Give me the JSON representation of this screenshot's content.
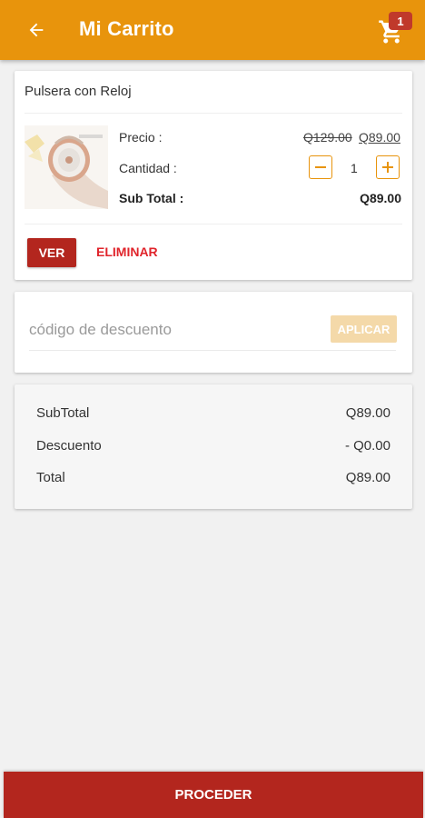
{
  "colors": {
    "brand": "#e8940c",
    "danger": "#b3261e",
    "link_danger": "#e0242b",
    "apply_disabled": "#f4d9a9"
  },
  "header": {
    "title": "Mi Carrito",
    "back_icon": "arrow-left-icon",
    "cart_icon": "shopping-cart-icon",
    "cart_count": "1"
  },
  "cart": {
    "items": [
      {
        "name": "Pulsera con Reloj",
        "image": "watch-bracelet",
        "price_label": "Precio :",
        "price_old": "Q129.00",
        "price_new": "Q89.00",
        "quantity_label": "Cantidad :",
        "quantity": "1",
        "subtotal_label": "Sub Total :",
        "subtotal": "Q89.00",
        "view_label": "VER",
        "remove_label": "ELIMINAR"
      }
    ]
  },
  "discount": {
    "placeholder": "código de descuento",
    "value": "",
    "apply_label": "APLICAR"
  },
  "summary": {
    "subtotal_label": "SubTotal",
    "subtotal_value": "Q89.00",
    "discount_label": "Descuento",
    "discount_value": "- Q0.00",
    "total_label": "Total",
    "total_value": "Q89.00"
  },
  "footer": {
    "proceed_label": "PROCEDER"
  }
}
